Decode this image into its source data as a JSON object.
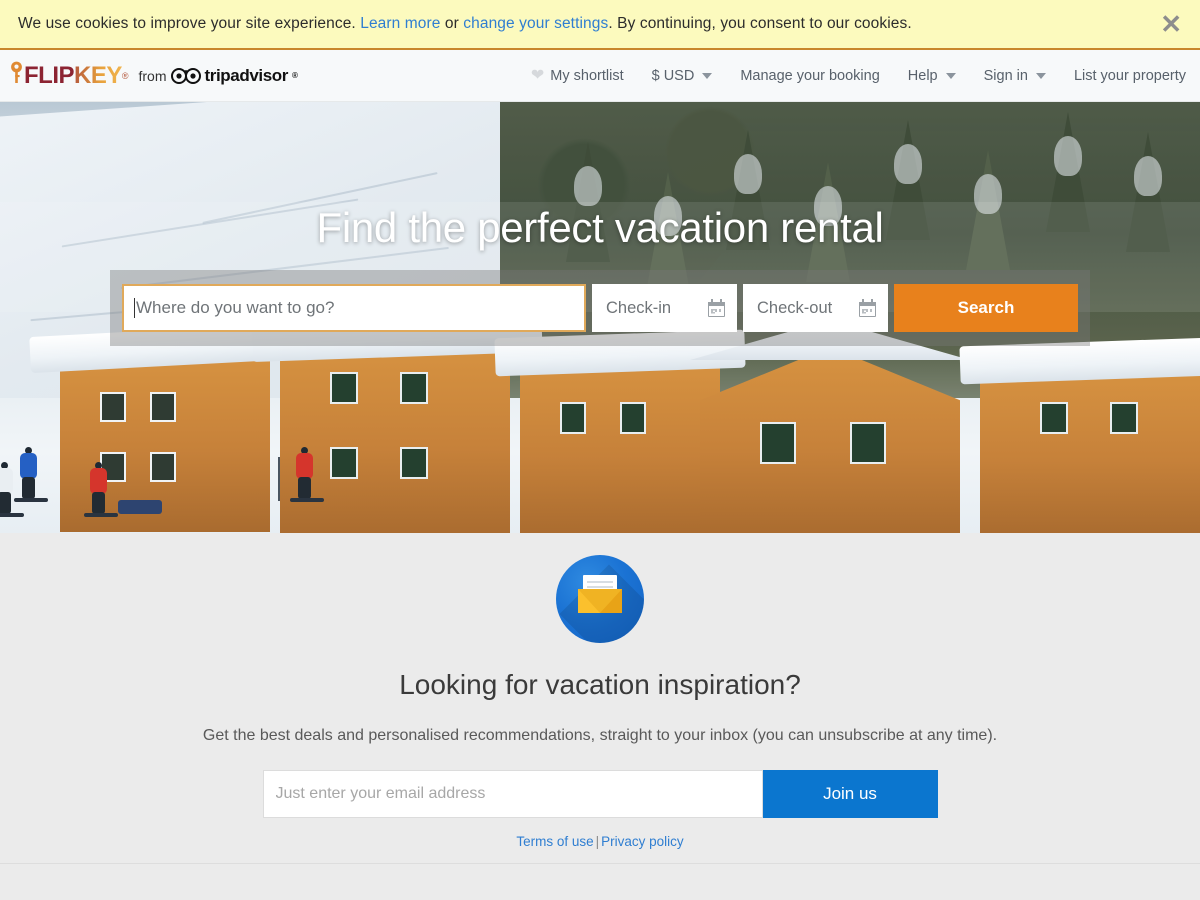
{
  "cookie_banner": {
    "text_before": "We use cookies to improve your site experience. ",
    "link_learn_more": "Learn more",
    "text_or": " or ",
    "link_change_settings": "change your settings",
    "text_after": ". By continuing, you consent to our cookies.",
    "close_label": "✕",
    "bg_color": "#fcfabe",
    "border_color": "#c8862c"
  },
  "header": {
    "brand": {
      "flip": "FLIP",
      "key": "KEY",
      "tm": "®",
      "from_word": "from",
      "tripadvisor": "tripadvisor",
      "tripadvisor_reg": "®"
    },
    "nav": [
      {
        "label": "My shortlist",
        "icon": "heart-icon",
        "has_chevron": false
      },
      {
        "label": "$ USD",
        "icon": null,
        "has_chevron": true
      },
      {
        "label": "Manage your booking",
        "icon": null,
        "has_chevron": false
      },
      {
        "label": "Help",
        "icon": null,
        "has_chevron": true
      },
      {
        "label": "Sign in",
        "icon": null,
        "has_chevron": true
      },
      {
        "label": "List your property",
        "icon": null,
        "has_chevron": false
      }
    ]
  },
  "hero": {
    "title": "Find the perfect vacation rental",
    "search": {
      "destination_placeholder": "Where do you want to go?",
      "destination_value": "",
      "checkin_label": "Check-in",
      "checkout_label": "Check-out",
      "search_button": "Search",
      "search_button_color": "#e8811c",
      "focus_border_color": "#e0a95a"
    }
  },
  "newsletter": {
    "icon": "envelope-mail-icon",
    "title": "Looking for vacation inspiration?",
    "subtitle": "Get the best deals and personalised recommendations, straight to your inbox (you can unsubscribe at any time).",
    "email_placeholder": "Just enter your email address",
    "email_value": "",
    "join_button": "Join us",
    "join_button_color": "#0b76cf",
    "terms_link": "Terms of use",
    "separator": "|",
    "privacy_link": "Privacy policy",
    "link_color": "#2f7ed1",
    "bg_color": "#ebebeb"
  }
}
